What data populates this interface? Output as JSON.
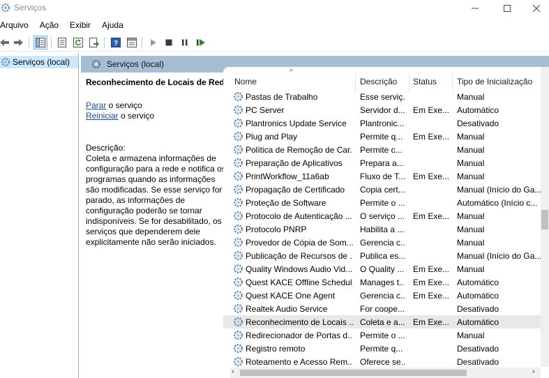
{
  "window": {
    "title": "Serviços",
    "icon": "gear-icon"
  },
  "menu": [
    "Arquivo",
    "Ação",
    "Exibir",
    "Ajuda"
  ],
  "tree": {
    "node_label": "Serviços (local)"
  },
  "pane": {
    "header_title": "Serviços (local)"
  },
  "details": {
    "service_name": "Reconhecimento de Locais de Rede",
    "stop_link": "Parar",
    "stop_suffix": " o serviço",
    "restart_link": "Reiniciar",
    "restart_suffix": " o serviço",
    "description_label": "Descrição:",
    "description_text": "Coleta e armazena informações de configuração para a rede e notifica os programas quando as informações são modificadas. Se esse serviço for parado, as informações de configuração poderão se tornar indisponíveis. Se for desabilitado, os serviços que dependerem dele explicitamente não serão iniciados."
  },
  "columns": {
    "name": "Nome",
    "description": "Descrição",
    "status": "Status",
    "startup": "Tipo de Inicialização"
  },
  "rows": [
    {
      "name": "Pastas de Trabalho",
      "description": "Esse serviç...",
      "status": "",
      "startup": "Manual"
    },
    {
      "name": "PC Server",
      "description": "Servidor d...",
      "status": "Em Exe...",
      "startup": "Automático"
    },
    {
      "name": "Plantronics Update Service",
      "description": "Plantronic...",
      "status": "",
      "startup": "Desativado"
    },
    {
      "name": "Plug and Play",
      "description": "Permite q...",
      "status": "Em Exe...",
      "startup": "Manual"
    },
    {
      "name": "Política de Remoção de Car...",
      "description": "Permite c...",
      "status": "",
      "startup": "Manual"
    },
    {
      "name": "Preparação de Aplicativos",
      "description": "Prepara a...",
      "status": "",
      "startup": "Manual"
    },
    {
      "name": "PrintWorkflow_11a6ab",
      "description": "Fluxo de T...",
      "status": "Em Exe...",
      "startup": "Manual"
    },
    {
      "name": "Propagação de Certificado",
      "description": "Copia cert...",
      "status": "",
      "startup": "Manual (Início do Ga..."
    },
    {
      "name": "Proteção de Software",
      "description": "Permite o ...",
      "status": "",
      "startup": "Automático (Início c..."
    },
    {
      "name": "Protocolo de Autenticação ...",
      "description": "O serviço ...",
      "status": "Em Exe...",
      "startup": "Manual"
    },
    {
      "name": "Protocolo PNRP",
      "description": "Habilita a ...",
      "status": "",
      "startup": "Manual"
    },
    {
      "name": "Provedor de Cópia de Som...",
      "description": "Gerencia c...",
      "status": "",
      "startup": "Manual"
    },
    {
      "name": "Publicação de Recursos de ...",
      "description": "Publica es...",
      "status": "",
      "startup": "Manual (Início do Ga..."
    },
    {
      "name": "Quality Windows Audio Vid...",
      "description": "O Quality ...",
      "status": "Em Exe...",
      "startup": "Manual"
    },
    {
      "name": "Quest KACE Offline Schedul...",
      "description": "Manages t...",
      "status": "Em Exe...",
      "startup": "Automático"
    },
    {
      "name": "Quest KACE One Agent",
      "description": "Gerencia c...",
      "status": "Em Exe...",
      "startup": "Automático"
    },
    {
      "name": "Realtek Audio Service",
      "description": "For coope...",
      "status": "",
      "startup": "Desativado"
    },
    {
      "name": "Reconhecimento de Locais ...",
      "description": "Coleta e a...",
      "status": "Em Exe...",
      "startup": "Automático",
      "selected": true
    },
    {
      "name": "Redirecionador de Portas d...",
      "description": "Permite o ...",
      "status": "",
      "startup": "Manual"
    },
    {
      "name": "Registro remoto",
      "description": "Permite q...",
      "status": "",
      "startup": "Desativado"
    },
    {
      "name": "Roteamento e Acesso Rem...",
      "description": "Oferece se...",
      "status": "",
      "startup": "Desativado"
    }
  ],
  "colors": {
    "accent_header": "#a7bdd4",
    "tree_selection": "#cce8ff",
    "row_selection": "#e8e8e8",
    "link": "#1a4a8a"
  }
}
